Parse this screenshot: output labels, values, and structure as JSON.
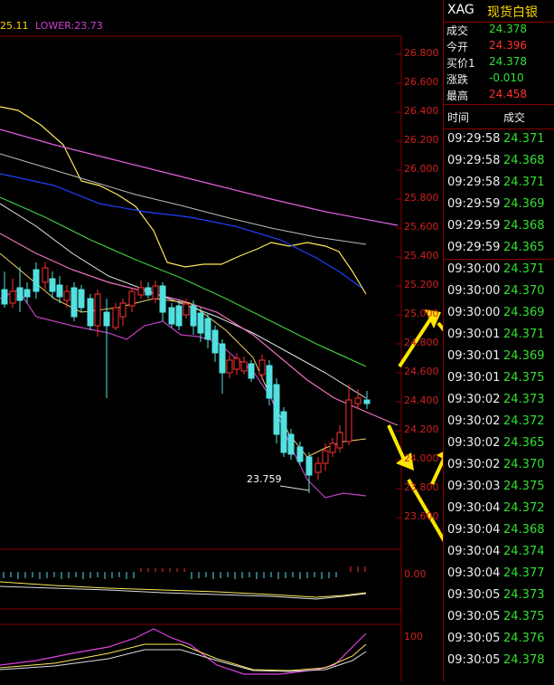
{
  "legend": {
    "upper_value": "25.11",
    "lower_label": "LOWER:23.73"
  },
  "price_axis": [
    "26.800",
    "26.600",
    "26.400",
    "26.200",
    "26.000",
    "25.800",
    "25.600",
    "25.400",
    "25.200",
    "25.000",
    "24.800",
    "24.600",
    "24.400",
    "24.200",
    "24.000",
    "23.800",
    "23.600"
  ],
  "annotation_low": "23.759",
  "macd_axis": "0.00",
  "kdj_axis": "100",
  "ticker": {
    "symbol": "XAG",
    "name": "现货白银",
    "quotes": [
      {
        "label": "成交",
        "value": "24.378",
        "color": "#31e031"
      },
      {
        "label": "今开",
        "value": "24.396",
        "color": "#ff3030"
      },
      {
        "label": "买价1",
        "value": "24.378",
        "color": "#31e031"
      },
      {
        "label": "涨跌",
        "value": "-0.010",
        "color": "#31e031"
      },
      {
        "label": "最高",
        "value": "24.458",
        "color": "#ff3030"
      }
    ],
    "trade_header": {
      "time": "时间",
      "volume": "成交"
    },
    "trades": [
      {
        "time": "09:29:58",
        "price": "24.371"
      },
      {
        "time": "09:29:58",
        "price": "24.368"
      },
      {
        "time": "09:29:58",
        "price": "24.371"
      },
      {
        "time": "09:29:59",
        "price": "24.369"
      },
      {
        "time": "09:29:59",
        "price": "24.368"
      },
      {
        "time": "09:29:59",
        "price": "24.365"
      },
      {
        "time": "09:30:00",
        "price": "24.371"
      },
      {
        "time": "09:30:00",
        "price": "24.370"
      },
      {
        "time": "09:30:00",
        "price": "24.369"
      },
      {
        "time": "09:30:01",
        "price": "24.371"
      },
      {
        "time": "09:30:01",
        "price": "24.369"
      },
      {
        "time": "09:30:01",
        "price": "24.375"
      },
      {
        "time": "09:30:02",
        "price": "24.373"
      },
      {
        "time": "09:30:02",
        "price": "24.372"
      },
      {
        "time": "09:30:02",
        "price": "24.365"
      },
      {
        "time": "09:30:02",
        "price": "24.370"
      },
      {
        "time": "09:30:03",
        "price": "24.375"
      },
      {
        "time": "09:30:04",
        "price": "24.372"
      },
      {
        "time": "09:30:04",
        "price": "24.368"
      },
      {
        "time": "09:30:04",
        "price": "24.374"
      },
      {
        "time": "09:30:04",
        "price": "24.377"
      },
      {
        "time": "09:30:05",
        "price": "24.373"
      },
      {
        "time": "09:30:05",
        "price": "24.375"
      },
      {
        "time": "09:30:05",
        "price": "24.376"
      },
      {
        "time": "09:30:05",
        "price": "24.378"
      }
    ]
  }
}
